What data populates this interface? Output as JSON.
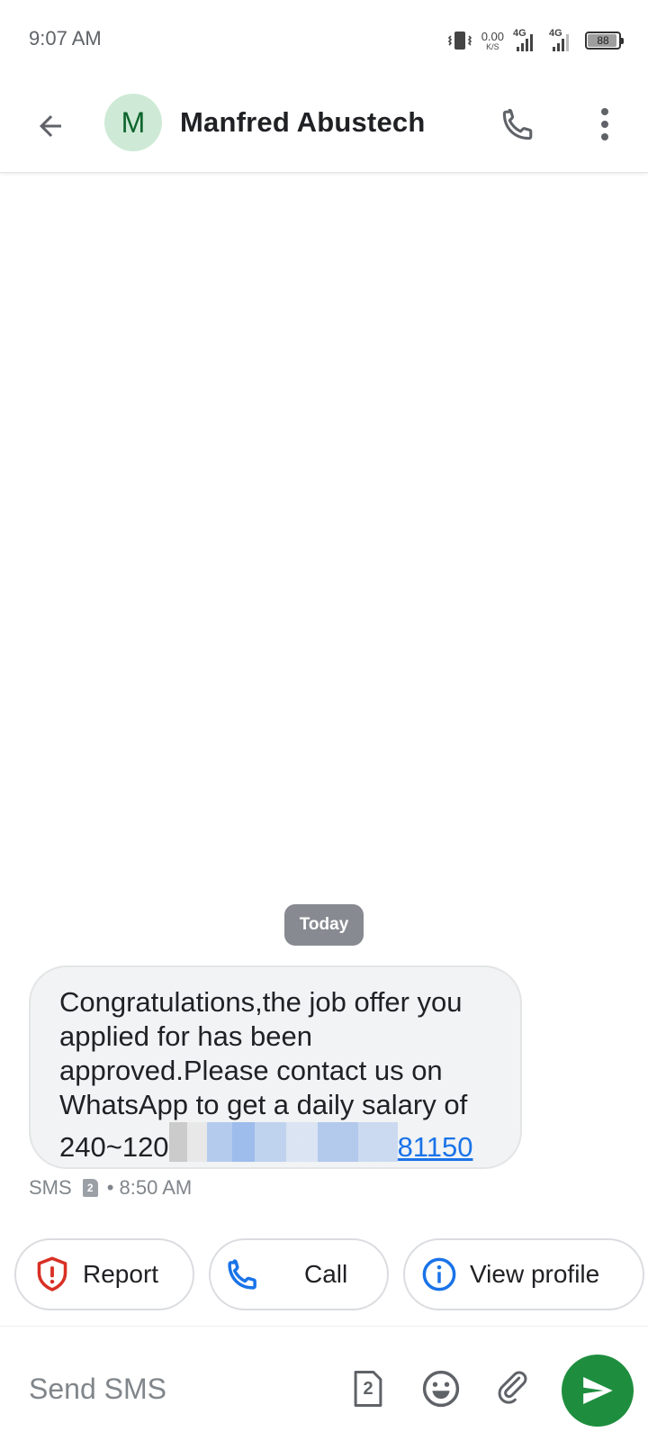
{
  "status_bar": {
    "time": "9:07 AM",
    "net_speed_value": "0.00",
    "net_speed_unit": "K/S",
    "sim1_label": "4G",
    "sim2_label": "4G",
    "battery": "88"
  },
  "header": {
    "avatar_letter": "M",
    "contact_name": "Manfred Abustech",
    "icons": {
      "back": "arrow-back-icon",
      "phone": "phone-icon",
      "menu": "more-vert-icon"
    }
  },
  "conversation": {
    "date_label": "Today",
    "message": {
      "text_before_redaction": "Congratulations,the job offer you applied for has been approved.Please contact us on WhatsApp to get a daily salary of 240~120",
      "link_tail": "81150",
      "channel": "SMS",
      "sim_slot": "2",
      "time": "• 8:50 AM"
    }
  },
  "actions": [
    {
      "label": "Report",
      "icon": "report-shield-icon"
    },
    {
      "label": "Call",
      "icon": "phone-icon"
    },
    {
      "label": "View profile",
      "icon": "info-icon"
    }
  ],
  "composer": {
    "placeholder": "Send SMS",
    "sim_slot": "2",
    "icons": {
      "sim": "sim-card-icon",
      "emoji": "emoji-icon",
      "attach": "attach-icon",
      "send": "send-icon"
    }
  },
  "colors": {
    "send_button": "#1e8e3e",
    "avatar_bg": "#ceead6",
    "avatar_fg": "#0d652d",
    "link": "#1a73e8",
    "report_icon": "#d93025",
    "call_icon": "#1a73e8",
    "date_chip": "#878b91"
  }
}
